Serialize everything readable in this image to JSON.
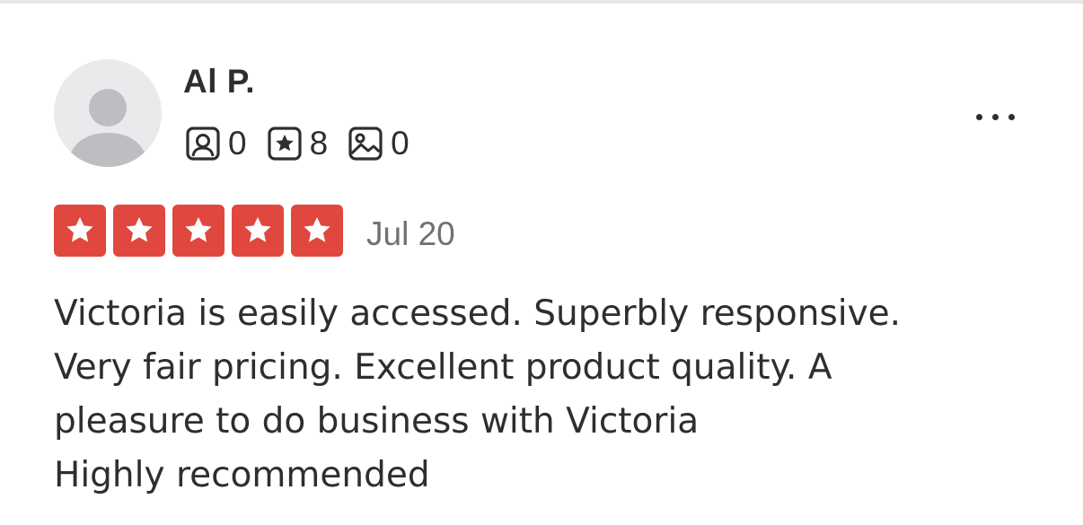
{
  "review": {
    "user": {
      "name": "Al P.",
      "avatar_icon": "default-avatar-icon",
      "stats": [
        {
          "icon": "friends-icon",
          "value": "0"
        },
        {
          "icon": "reviews-icon",
          "value": "8"
        },
        {
          "icon": "photos-icon",
          "value": "0"
        }
      ]
    },
    "more_icon": "more-options-icon",
    "rating": {
      "stars": 5,
      "max": 5,
      "color": "#e0473f"
    },
    "date": "Jul 20",
    "text_lines": [
      "Victoria is easily accessed. Superbly responsive.",
      "Very fair pricing. Excellent product quality. A",
      "pleasure to do business with Victoria",
      "Highly recommended"
    ]
  },
  "colors": {
    "text": "#2d2e2f",
    "muted": "#6e7072",
    "star_bg": "#e0473f",
    "avatar_bg": "#eaeaec"
  }
}
